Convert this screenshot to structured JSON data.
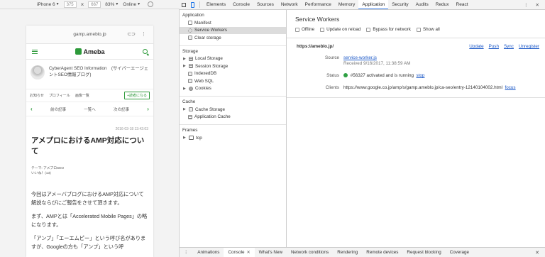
{
  "device_toolbar": {
    "device": "iPhone 6",
    "width": "375",
    "height": "667",
    "zoom": "83%",
    "network": "Online"
  },
  "phone": {
    "url": "gamp.ameblo.jp",
    "logo": "Ameba",
    "blog_title": "CyberAgent SEO Information　(サイバーエージェントSEO情報ブログ)",
    "nav": [
      "お知らせ",
      "プロフィール",
      "画像一覧"
    ],
    "follow": "+読者になる",
    "prev": "前の記事",
    "list": "一覧へ",
    "next": "次の記事",
    "date": "2016-03-18 13:42:03",
    "title": "アメプロにおけるAMP対応について",
    "theme": "テーマ: アメブロSEO",
    "likes": "いいね！(13)",
    "body": [
      "今回はアメーバブログにおけるAMP対応について解説ならびにご報告をさせて頂きます。",
      "まず、AMPとは「Accelerated Mobile Pages」の略になります。",
      "「アンプ」「エーエムピー」という呼び名がありますが、Googleの方も「アンプ」という呼"
    ]
  },
  "devtools": {
    "tabs": [
      "Elements",
      "Console",
      "Sources",
      "Network",
      "Performance",
      "Memory",
      "Application",
      "Security",
      "Audits",
      "Redux",
      "React"
    ],
    "active_tab": "Application",
    "more": "⋮",
    "close": "✕",
    "sidebar": {
      "application": "Application",
      "app_items": [
        "Manifest",
        "Service Workers",
        "Clear storage"
      ],
      "storage": "Storage",
      "storage_items": [
        "Local Storage",
        "Session Storage",
        "IndexedDB",
        "Web SQL",
        "Cookies"
      ],
      "cache": "Cache",
      "cache_items": [
        "Cache Storage",
        "Application Cache"
      ],
      "frames": "Frames",
      "frame_items": [
        "top"
      ]
    },
    "sw": {
      "title": "Service Workers",
      "options": [
        "Offline",
        "Update on reload",
        "Bypass for network",
        "Show all"
      ],
      "origin": "https://ameblo.jp/",
      "actions": [
        "Update",
        "Push",
        "Sync",
        "Unregister"
      ],
      "source_label": "Source",
      "source_link": "service-worker.js",
      "received": "Received 9/16/2017, 11:38:59 AM",
      "status_label": "Status",
      "status_text": "#56327 activated and is running",
      "stop": "stop",
      "clients_label": "Clients",
      "clients_url": "https://www.google.co.jp/amp/s/gamp.ameblo.jp/ca-seo/entry-12140104002.html",
      "focus": "focus"
    },
    "drawer": {
      "menu": "⋮",
      "tabs": [
        "Animations",
        "Console",
        "What's New",
        "Network conditions",
        "Rendering",
        "Remote devices",
        "Request blocking",
        "Coverage"
      ],
      "active": "Console",
      "close": "✕"
    }
  },
  "colors": {
    "ameba_green": "#2d9a3a",
    "link_blue": "#1a57c7",
    "status_green": "#2ea043"
  }
}
